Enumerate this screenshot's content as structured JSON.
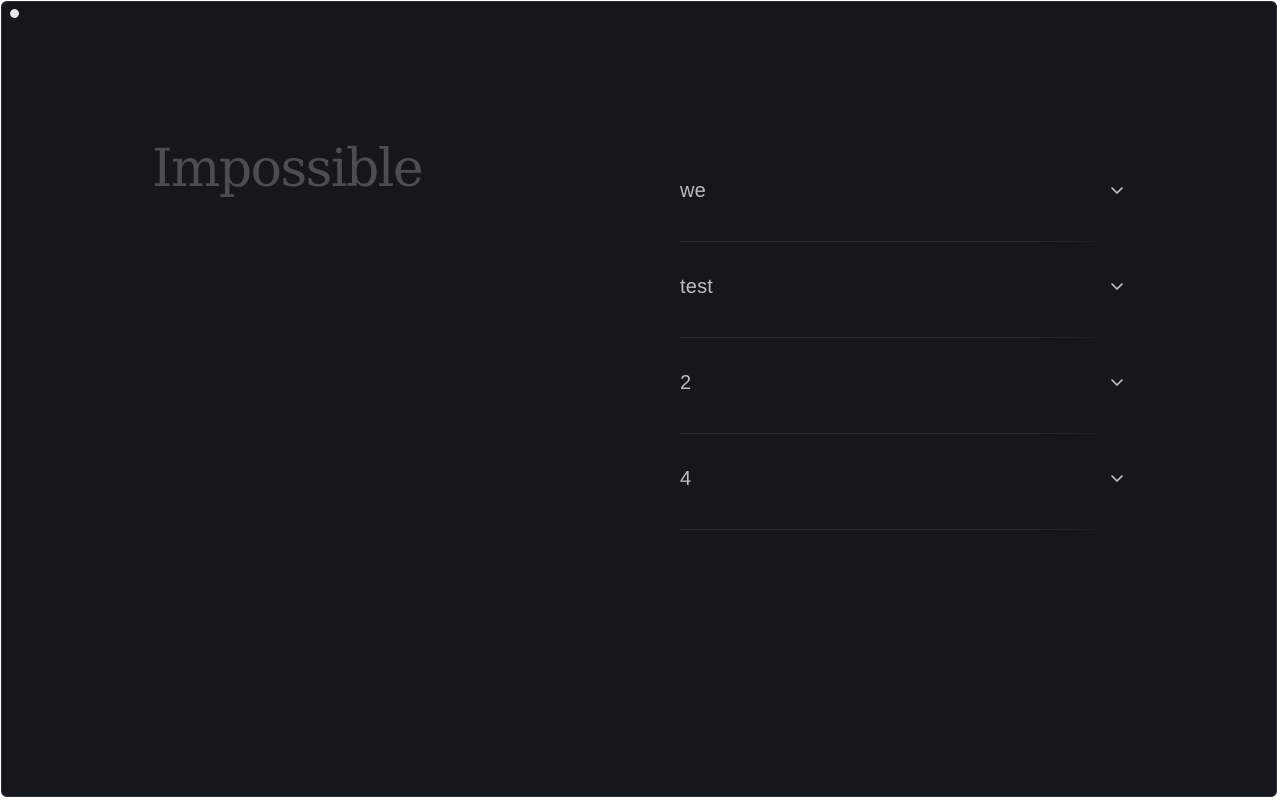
{
  "app": {
    "title": "Impossible"
  },
  "accordion": {
    "items": [
      {
        "label": "we"
      },
      {
        "label": "test"
      },
      {
        "label": "2"
      },
      {
        "label": "4"
      }
    ]
  },
  "icons": {
    "status": "status-dot",
    "expand": "chevron-down-icon"
  },
  "colors": {
    "background": "#14171b",
    "title": "#4b4d51",
    "label": "#b9bcc2",
    "divider": "#2a2e34"
  }
}
